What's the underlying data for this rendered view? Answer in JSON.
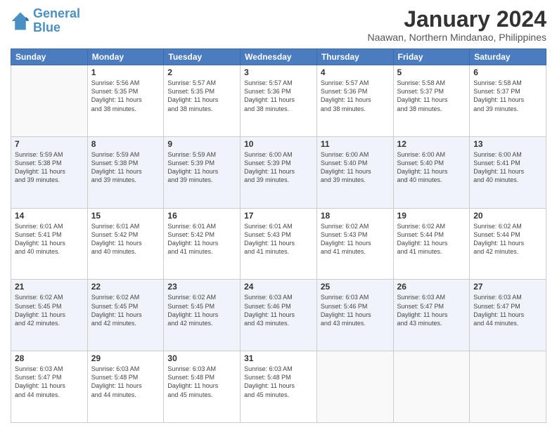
{
  "header": {
    "logo_line1": "General",
    "logo_line2": "Blue",
    "main_title": "January 2024",
    "subtitle": "Naawan, Northern Mindanao, Philippines"
  },
  "days_of_week": [
    "Sunday",
    "Monday",
    "Tuesday",
    "Wednesday",
    "Thursday",
    "Friday",
    "Saturday"
  ],
  "weeks": [
    [
      {
        "day": "",
        "info": ""
      },
      {
        "day": "1",
        "info": "Sunrise: 5:56 AM\nSunset: 5:35 PM\nDaylight: 11 hours\nand 38 minutes."
      },
      {
        "day": "2",
        "info": "Sunrise: 5:57 AM\nSunset: 5:35 PM\nDaylight: 11 hours\nand 38 minutes."
      },
      {
        "day": "3",
        "info": "Sunrise: 5:57 AM\nSunset: 5:36 PM\nDaylight: 11 hours\nand 38 minutes."
      },
      {
        "day": "4",
        "info": "Sunrise: 5:57 AM\nSunset: 5:36 PM\nDaylight: 11 hours\nand 38 minutes."
      },
      {
        "day": "5",
        "info": "Sunrise: 5:58 AM\nSunset: 5:37 PM\nDaylight: 11 hours\nand 38 minutes."
      },
      {
        "day": "6",
        "info": "Sunrise: 5:58 AM\nSunset: 5:37 PM\nDaylight: 11 hours\nand 39 minutes."
      }
    ],
    [
      {
        "day": "7",
        "info": "Sunrise: 5:59 AM\nSunset: 5:38 PM\nDaylight: 11 hours\nand 39 minutes."
      },
      {
        "day": "8",
        "info": "Sunrise: 5:59 AM\nSunset: 5:38 PM\nDaylight: 11 hours\nand 39 minutes."
      },
      {
        "day": "9",
        "info": "Sunrise: 5:59 AM\nSunset: 5:39 PM\nDaylight: 11 hours\nand 39 minutes."
      },
      {
        "day": "10",
        "info": "Sunrise: 6:00 AM\nSunset: 5:39 PM\nDaylight: 11 hours\nand 39 minutes."
      },
      {
        "day": "11",
        "info": "Sunrise: 6:00 AM\nSunset: 5:40 PM\nDaylight: 11 hours\nand 39 minutes."
      },
      {
        "day": "12",
        "info": "Sunrise: 6:00 AM\nSunset: 5:40 PM\nDaylight: 11 hours\nand 40 minutes."
      },
      {
        "day": "13",
        "info": "Sunrise: 6:00 AM\nSunset: 5:41 PM\nDaylight: 11 hours\nand 40 minutes."
      }
    ],
    [
      {
        "day": "14",
        "info": "Sunrise: 6:01 AM\nSunset: 5:41 PM\nDaylight: 11 hours\nand 40 minutes."
      },
      {
        "day": "15",
        "info": "Sunrise: 6:01 AM\nSunset: 5:42 PM\nDaylight: 11 hours\nand 40 minutes."
      },
      {
        "day": "16",
        "info": "Sunrise: 6:01 AM\nSunset: 5:42 PM\nDaylight: 11 hours\nand 41 minutes."
      },
      {
        "day": "17",
        "info": "Sunrise: 6:01 AM\nSunset: 5:43 PM\nDaylight: 11 hours\nand 41 minutes."
      },
      {
        "day": "18",
        "info": "Sunrise: 6:02 AM\nSunset: 5:43 PM\nDaylight: 11 hours\nand 41 minutes."
      },
      {
        "day": "19",
        "info": "Sunrise: 6:02 AM\nSunset: 5:44 PM\nDaylight: 11 hours\nand 41 minutes."
      },
      {
        "day": "20",
        "info": "Sunrise: 6:02 AM\nSunset: 5:44 PM\nDaylight: 11 hours\nand 42 minutes."
      }
    ],
    [
      {
        "day": "21",
        "info": "Sunrise: 6:02 AM\nSunset: 5:45 PM\nDaylight: 11 hours\nand 42 minutes."
      },
      {
        "day": "22",
        "info": "Sunrise: 6:02 AM\nSunset: 5:45 PM\nDaylight: 11 hours\nand 42 minutes."
      },
      {
        "day": "23",
        "info": "Sunrise: 6:02 AM\nSunset: 5:45 PM\nDaylight: 11 hours\nand 42 minutes."
      },
      {
        "day": "24",
        "info": "Sunrise: 6:03 AM\nSunset: 5:46 PM\nDaylight: 11 hours\nand 43 minutes."
      },
      {
        "day": "25",
        "info": "Sunrise: 6:03 AM\nSunset: 5:46 PM\nDaylight: 11 hours\nand 43 minutes."
      },
      {
        "day": "26",
        "info": "Sunrise: 6:03 AM\nSunset: 5:47 PM\nDaylight: 11 hours\nand 43 minutes."
      },
      {
        "day": "27",
        "info": "Sunrise: 6:03 AM\nSunset: 5:47 PM\nDaylight: 11 hours\nand 44 minutes."
      }
    ],
    [
      {
        "day": "28",
        "info": "Sunrise: 6:03 AM\nSunset: 5:47 PM\nDaylight: 11 hours\nand 44 minutes."
      },
      {
        "day": "29",
        "info": "Sunrise: 6:03 AM\nSunset: 5:48 PM\nDaylight: 11 hours\nand 44 minutes."
      },
      {
        "day": "30",
        "info": "Sunrise: 6:03 AM\nSunset: 5:48 PM\nDaylight: 11 hours\nand 45 minutes."
      },
      {
        "day": "31",
        "info": "Sunrise: 6:03 AM\nSunset: 5:48 PM\nDaylight: 11 hours\nand 45 minutes."
      },
      {
        "day": "",
        "info": ""
      },
      {
        "day": "",
        "info": ""
      },
      {
        "day": "",
        "info": ""
      }
    ]
  ]
}
